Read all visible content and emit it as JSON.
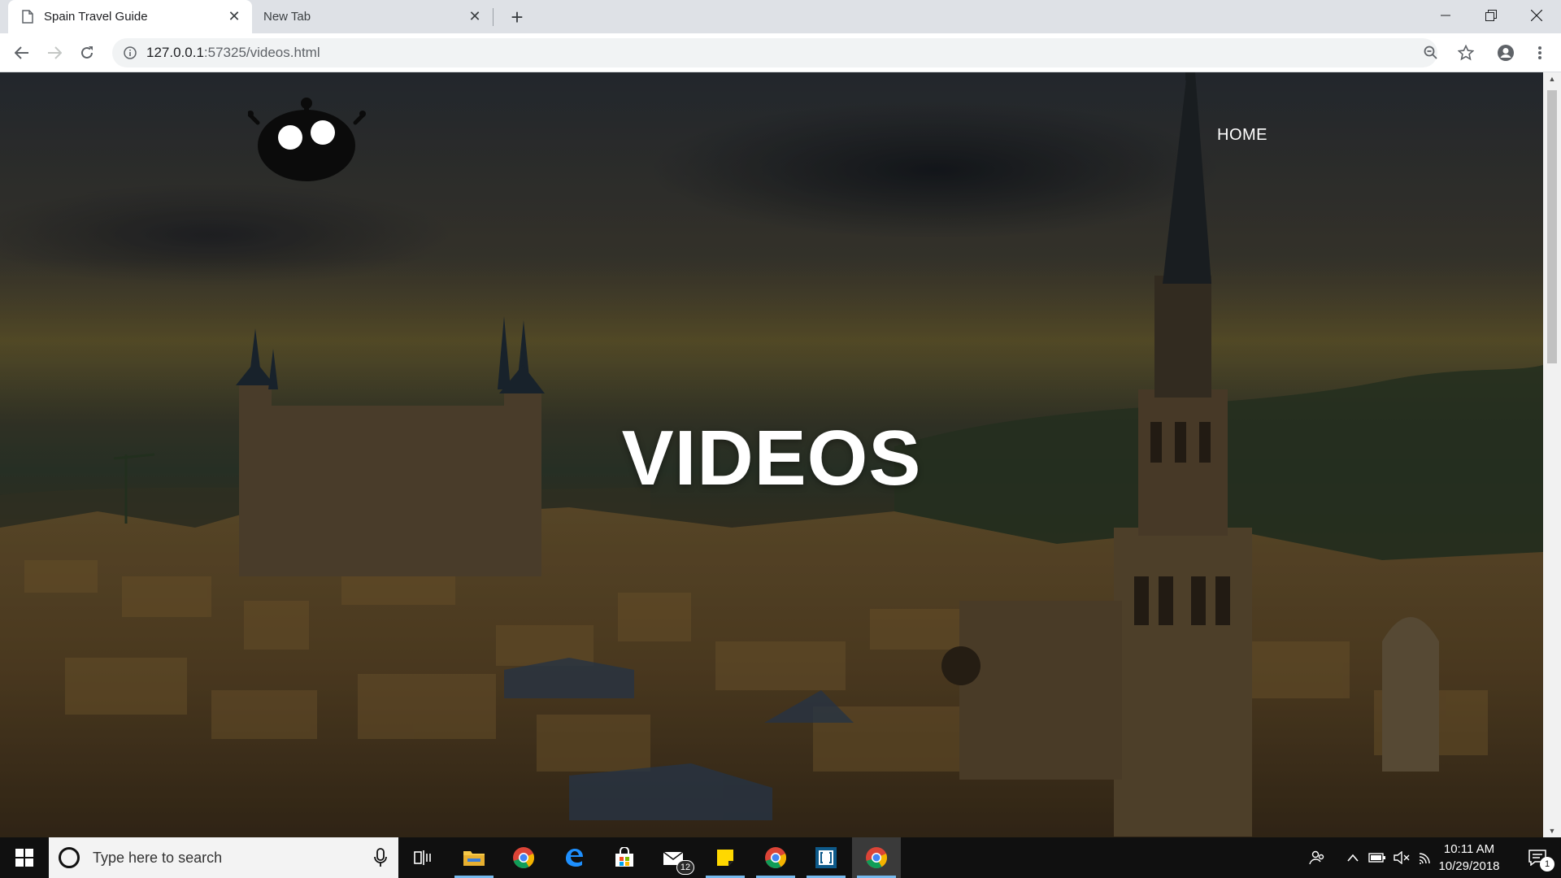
{
  "browser": {
    "tabs": [
      {
        "title": "Spain Travel Guide",
        "active": true
      },
      {
        "title": "New Tab",
        "active": false
      }
    ],
    "url": {
      "host": "127.0.0.1",
      "rest": ":57325/videos.html"
    }
  },
  "page": {
    "nav": {
      "home_label": "HOME"
    },
    "hero_title": "VIDEOS"
  },
  "taskbar": {
    "search_placeholder": "Type here to search",
    "mail_badge": "12",
    "clock_time": "10:11 AM",
    "clock_date": "10/29/2018",
    "notification_count": "1"
  },
  "colors": {
    "tabstrip_bg": "#dee1e6",
    "taskbar_bg": "#101010",
    "hero_text": "#ffffff",
    "running_indicator": "#76b9ed"
  }
}
